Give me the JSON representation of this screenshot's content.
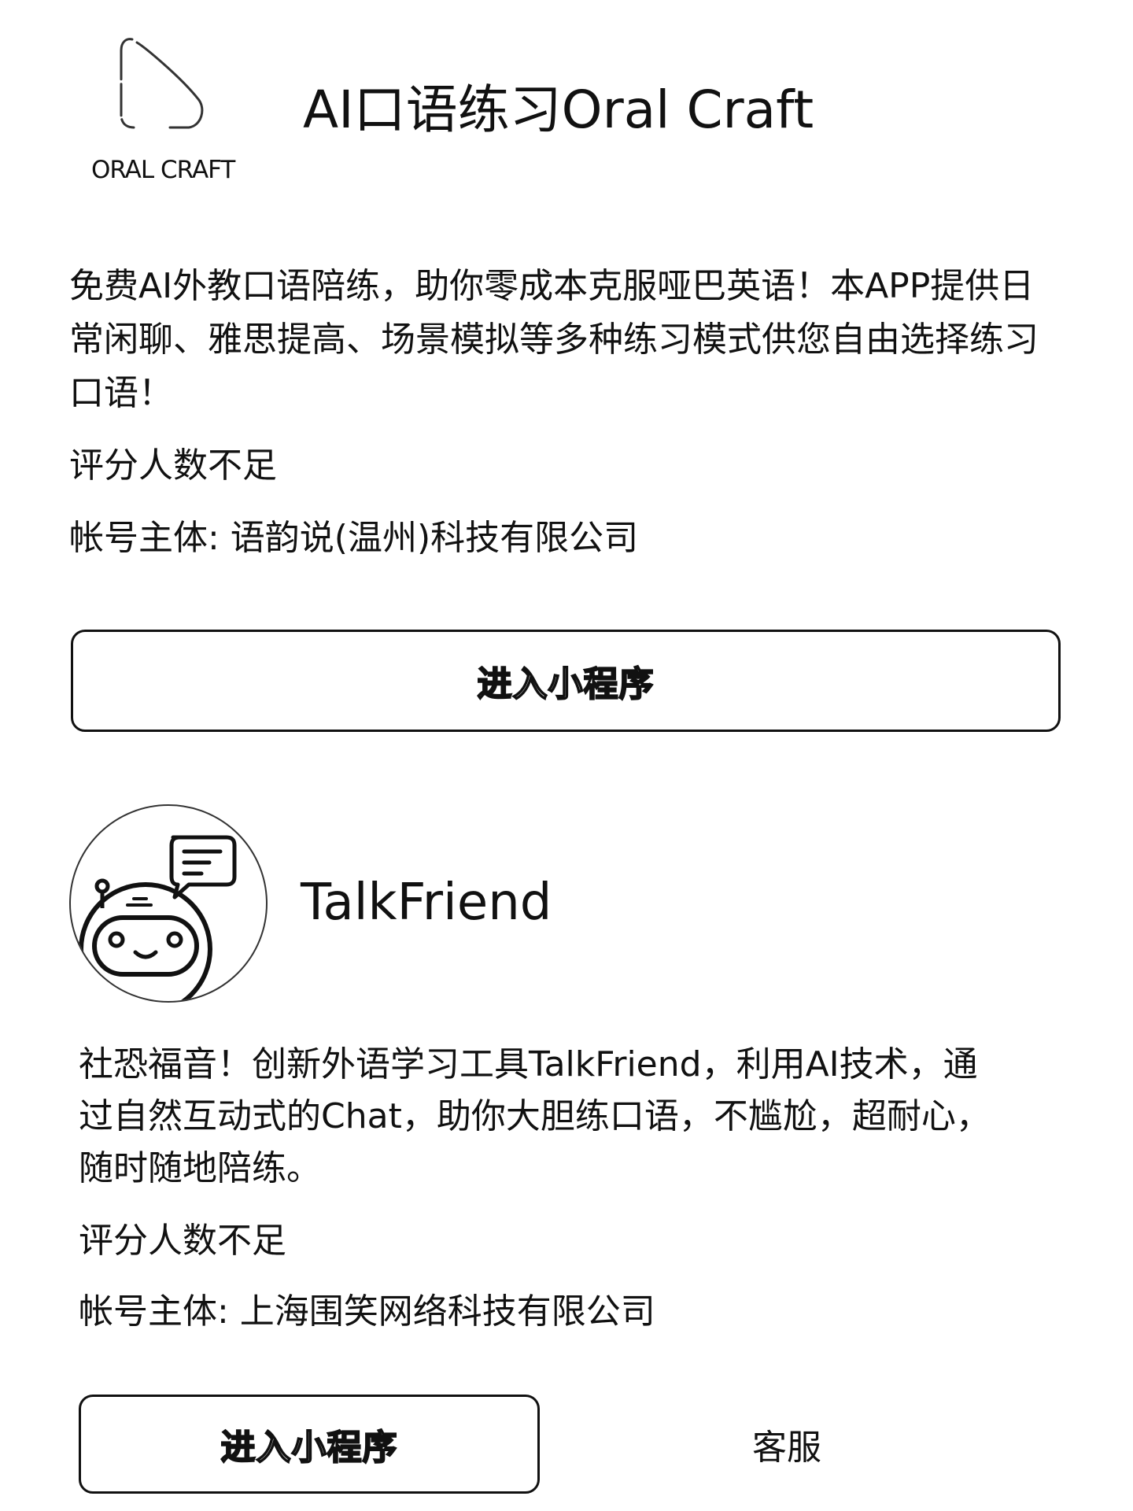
{
  "cards": [
    {
      "logo_text": "ORAL CRAFT",
      "logo_icon": "triangle-logo-icon",
      "title": "AI口语练习Oral Craft",
      "description": "免费AI外教口语陪练，助你零成本克服哑巴英语！本APP提供日常闲聊、雅思提高、场景模拟等多种练习模式供您自由选择练习口语！",
      "rating": "评分人数不足",
      "account": "帐号主体: 语韵说(温州)科技有限公司",
      "enter_label": "进入小程序"
    },
    {
      "avatar_icon": "robot-chat-icon",
      "title": "TalkFriend",
      "description": "社恐福音！创新外语学习工具TalkFriend，利用AI技术，通过自然互动式的Chat，助你大胆练口语，不尴尬，超耐心，随时随地陪练。",
      "rating": "评分人数不足",
      "account": "帐号主体: 上海围笑网络科技有限公司",
      "enter_label": "进入小程序",
      "service_label": "客服"
    }
  ]
}
